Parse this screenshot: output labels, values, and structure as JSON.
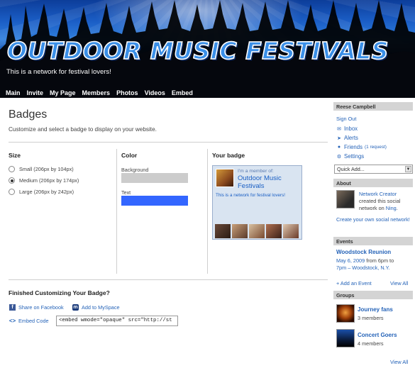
{
  "header": {
    "site_title": "OUTDOOR MUSIC FESTIVALS",
    "tagline": "This is a network for festival lovers!",
    "nav": [
      "Main",
      "Invite",
      "My Page",
      "Members",
      "Photos",
      "Videos",
      "Embed"
    ]
  },
  "page": {
    "title": "Badges",
    "description": "Customize and select a badge to display on your website."
  },
  "size": {
    "heading": "Size",
    "options": [
      "Small (206px by 104px)",
      "Medium (206px by 174px)",
      "Large (206px by 242px)"
    ],
    "selected": "Medium (206px by 174px)"
  },
  "color": {
    "heading": "Color",
    "background_label": "Background",
    "background_value": "#cccccc",
    "text_label": "Text",
    "text_value": "#3366ff"
  },
  "badge": {
    "heading": "Your badge",
    "member_of": "I'm a member of:",
    "network_name": "Outdoor Music Festivals",
    "tagline": "This is a network for festival lovers!"
  },
  "finish": {
    "heading": "Finished Customizing Your Badge?",
    "share_facebook": "Share on Facebook",
    "add_myspace": "Add to MySpace",
    "embed_code_label": "Embed Code",
    "embed_code_value": "<embed wmode=\"opaque\" src=\"http://st"
  },
  "sidebar": {
    "user_name": "Reese Campbell",
    "sign_out": "Sign Out",
    "inbox": "Inbox",
    "alerts": "Alerts",
    "friends": "Friends",
    "friends_request": "(1 request)",
    "settings": "Settings",
    "quick_add": "Quick Add...",
    "about": {
      "heading": "About",
      "creator": "Network Creator",
      "created_text": "created this social network on",
      "ning": "Ning",
      "create_own": "Create your own social network!"
    },
    "events": {
      "heading": "Events",
      "event_title": "Woodstock Reunion",
      "date": "May 6, 2009",
      "from_text": "from 6pm to",
      "time_loc": "7pm – Woodstock, N.Y.",
      "add_event": "+ Add an Event",
      "view_all": "View All"
    },
    "groups": {
      "heading": "Groups",
      "items": [
        {
          "name": "Journey fans",
          "members": "3 members"
        },
        {
          "name": "Concert Goers",
          "members": "4 members"
        }
      ],
      "view_all": "View All"
    }
  },
  "colors": {
    "link": "#2563b8",
    "heading_bar": "#d4d4d4",
    "banner_blue": "#2f7fdd"
  }
}
